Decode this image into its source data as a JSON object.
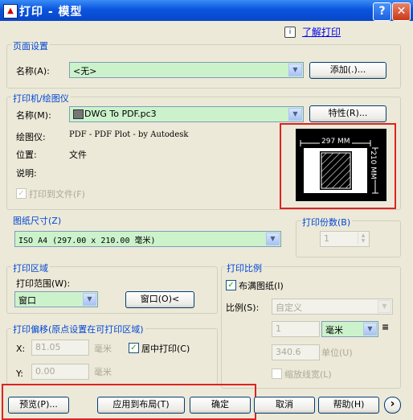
{
  "window": {
    "title": "打印 - 模型",
    "app_icon": "▲",
    "help": "?",
    "close": "✕"
  },
  "help_link": {
    "icon": "i",
    "text": "了解打印"
  },
  "page_setup": {
    "title": "页面设置",
    "name_label": "名称(A):",
    "name_value": "<无>",
    "add_button": "添加(.)..."
  },
  "printer": {
    "title": "打印机/绘图仪",
    "name_label": "名称(M):",
    "name_value": "DWG To PDF.pc3",
    "properties_button": "特性(R)...",
    "plotter_label": "绘图仪:",
    "plotter_value": "PDF - PDF Plot - by Autodesk",
    "location_label": "位置:",
    "location_value": "文件",
    "description_label": "说明:",
    "print_to_file": "打印到文件(F)",
    "preview_width": "297 MM",
    "preview_height": "210 MM"
  },
  "paper_size": {
    "title": "图纸尺寸(Z)",
    "value": "ISO A4 (297.00 x 210.00 毫米)"
  },
  "copies": {
    "title": "打印份数(B)",
    "value": "1"
  },
  "plot_area": {
    "title": "打印区域",
    "range_label": "打印范围(W):",
    "range_value": "窗口",
    "window_button": "窗口(O)<"
  },
  "plot_offset": {
    "title": "打印偏移(原点设置在可打印区域)",
    "x_label": "X:",
    "x_value": "81.05",
    "x_unit": "毫米",
    "y_label": "Y:",
    "y_value": "0.00",
    "y_unit": "毫米",
    "center_label": "居中打印(C)"
  },
  "plot_scale": {
    "title": "打印比例",
    "fit_label": "布满图纸(I)",
    "scale_label": "比例(S):",
    "scale_value": "自定义",
    "value1": "1",
    "unit1": "毫米",
    "value2": "340.6",
    "unit2": "单位(U)",
    "lineweight_label": "缩放线宽(L)"
  },
  "footer": {
    "preview": "预览(P)...",
    "apply": "应用到布局(T)",
    "ok": "确定",
    "cancel": "取消",
    "help": "帮助(H)",
    "more": "›"
  }
}
